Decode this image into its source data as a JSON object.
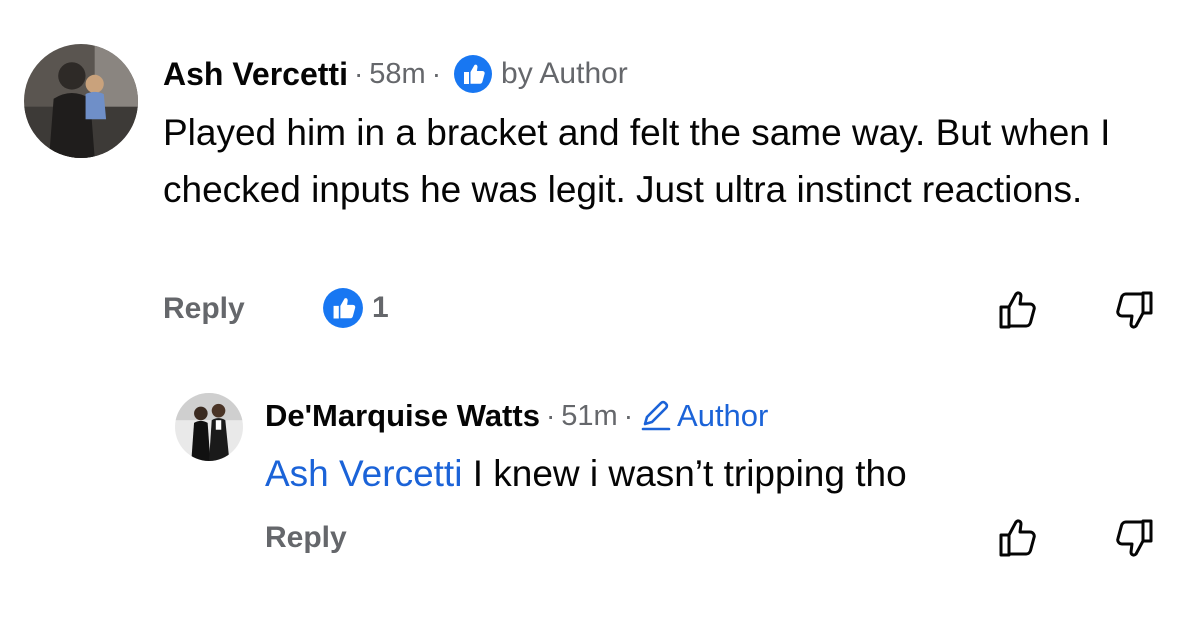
{
  "colors": {
    "text": "#050505",
    "secondary": "#65676b",
    "link_blue": "#1b63d8",
    "like_blue": "#1877f2"
  },
  "comments": [
    {
      "author": "Ash Vercetti",
      "time": "58m",
      "separator": "·",
      "badge_icon": "thumbs-up-filled-icon",
      "badge_text": "by Author",
      "text": "Played him in a bracket and felt the same way. But when I checked inputs he was legit. Just ultra instinct reactions.",
      "reply_label": "Reply",
      "reaction_icon": "like-reaction-icon",
      "reaction_count": "1"
    },
    {
      "author": "De'Marquise Watts",
      "time": "51m",
      "separator": "·",
      "author_icon": "pencil-icon",
      "author_tag": "Author",
      "mention": "Ash Vercetti",
      "text": " I knew i wasn’t tripping tho",
      "reply_label": "Reply"
    }
  ]
}
